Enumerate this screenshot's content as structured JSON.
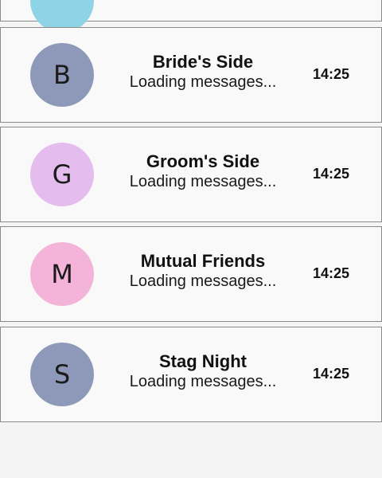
{
  "chats": [
    {
      "initial": "B",
      "name": "Bride's Side",
      "preview": "Loading messages...",
      "time": "14:25",
      "avatar_color": "#8e98b9"
    },
    {
      "initial": "G",
      "name": "Groom's Side",
      "preview": "Loading messages...",
      "time": "14:25",
      "avatar_color": "#e4bdee"
    },
    {
      "initial": "M",
      "name": "Mutual Friends",
      "preview": "Loading messages...",
      "time": "14:25",
      "avatar_color": "#f4b3d8"
    },
    {
      "initial": "S",
      "name": "Stag Night",
      "preview": "Loading messages...",
      "time": "14:25",
      "avatar_color": "#8e98b9"
    }
  ],
  "partial_avatar_color": "#8fd3e6"
}
